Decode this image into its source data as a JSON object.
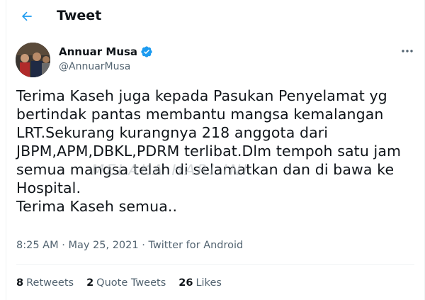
{
  "header": {
    "back_icon": "arrow-left-icon",
    "title": "Tweet"
  },
  "author": {
    "display_name": "Annuar Musa",
    "handle": "@AnnuarMusa",
    "verified_icon": "verified-badge-icon",
    "verified_color": "#1d9bf0"
  },
  "tweet": {
    "text": "Terima Kaseh juga kepada Pasukan Penyelamat yg\nbertindak pantas membantu mangsa kemalangan\nLRT.Sekurang kurangnya 218 anggota dari\nJBPM,APM,DBKL,PDRM terlibat.Dlm tempoh satu jam\nsemua mangsa telah di selamatkan dan di bawa ke\nHospital.\nTerima Kaseh semua..",
    "time": "8:25 AM",
    "separator": " · ",
    "date": "May 25, 2021",
    "source": "Twitter for Android"
  },
  "watermark": "MELAKA HARI INI",
  "stats": {
    "retweets_count": "8",
    "retweets_label": "Retweets",
    "quotes_count": "2",
    "quotes_label": "Quote Tweets",
    "likes_count": "26",
    "likes_label": "Likes"
  },
  "colors": {
    "accent": "#1d9bf0",
    "text": "#0f1419",
    "secondary": "#536471",
    "border": "#eff3f4"
  }
}
